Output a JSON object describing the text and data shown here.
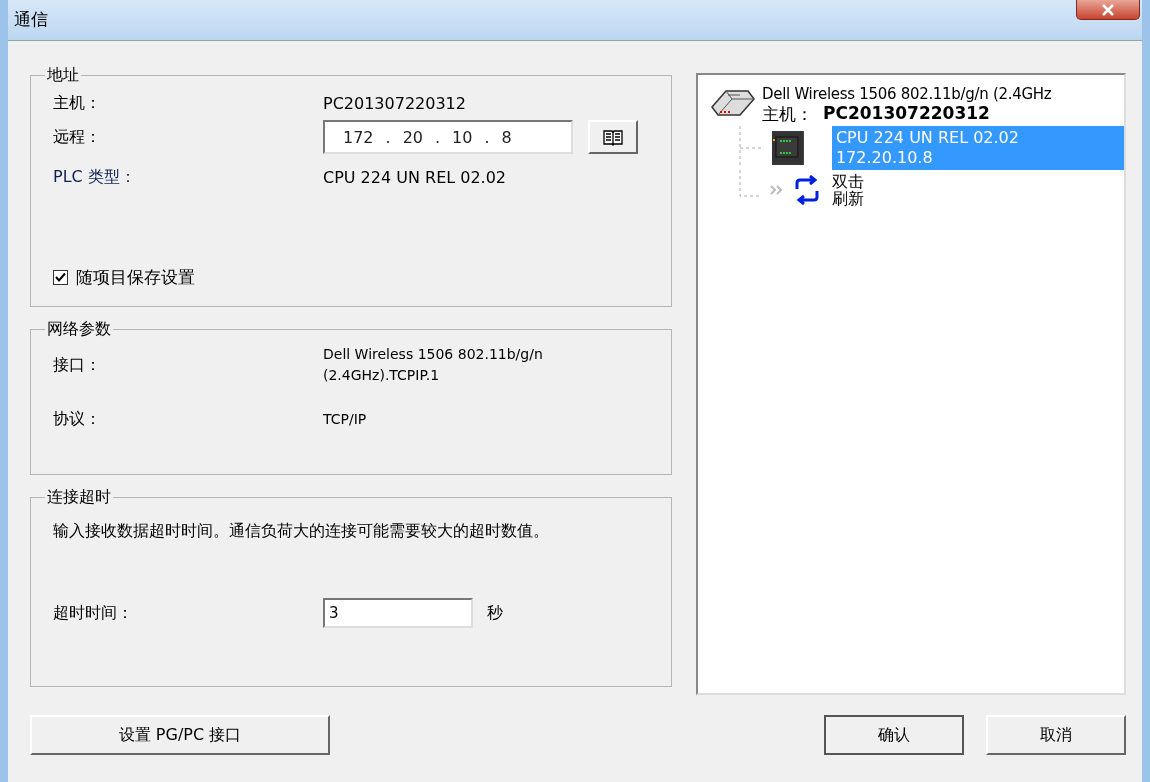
{
  "window": {
    "title": "通信"
  },
  "address": {
    "legend": "地址",
    "host_label": "主机：",
    "host": "PC201307220312",
    "remote_label": "远程：",
    "remote_octets": [
      "172",
      "20",
      "10",
      "8"
    ],
    "remote_separator": ".",
    "plc_label": "PLC 类型：",
    "plc": "CPU 224 UN REL 02.02",
    "save_setting": {
      "label": "随项目保存设置",
      "checked": true
    }
  },
  "network": {
    "legend": "网络参数",
    "interface_label": "接口：",
    "interface": "Dell Wireless 1506 802.11b/g/n (2.4GHz).TCPIP.1",
    "protocol_label": "协议：",
    "protocol": "TCP/IP"
  },
  "timeout": {
    "legend": "连接超时",
    "description": "输入接收数据超时时间。通信负荷大的连接可能需要较大的超时数值。",
    "label": "超时时间：",
    "value": "3",
    "unit": "秒"
  },
  "tree": {
    "adapter": "Dell Wireless 1506 802.11b/g/n (2.4GHz",
    "host_label": "主机：",
    "host": "PC201307220312",
    "children": [
      {
        "kind": "device",
        "lines": [
          "CPU 224 UN REL 02.02",
          "172.20.10.8"
        ],
        "selected": true
      },
      {
        "kind": "refresh",
        "lines": [
          "双击",
          "刷新"
        ],
        "selected": false
      }
    ]
  },
  "buttons": {
    "pgpc": "设置 PG/PC 接口",
    "ok": "确认",
    "cancel": "取消"
  }
}
